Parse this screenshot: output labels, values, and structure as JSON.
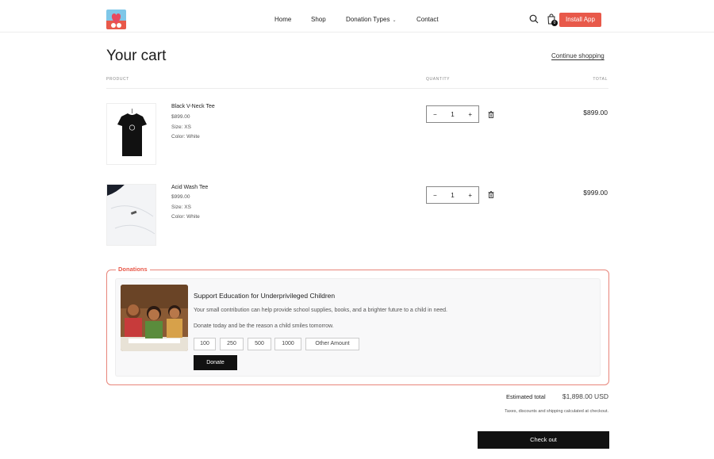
{
  "header": {
    "nav": [
      "Home",
      "Shop",
      "Donation Types",
      "Contact"
    ],
    "cart_count": "0",
    "install_label": "Install App"
  },
  "cart": {
    "title": "Your cart",
    "continue_label": "Continue shopping",
    "columns": {
      "product": "PRODUCT",
      "quantity": "QUANTITY",
      "total": "TOTAL"
    },
    "items": [
      {
        "name": "Black V-Neck Tee",
        "price": "$899.00",
        "size": "Size: XS",
        "color": "Color: White",
        "qty": "1",
        "total": "$899.00"
      },
      {
        "name": "Acid Wash Tee",
        "price": "$999.00",
        "size": "Size: XS",
        "color": "Color: White",
        "qty": "1",
        "total": "$999.00"
      }
    ],
    "minus": "−",
    "plus": "+"
  },
  "donations": {
    "legend": "Donations",
    "title": "Support Education for Underprivileged Children",
    "text1": "Your small contribution can help provide school supplies, books, and a brighter future to a child in need.",
    "text2": "Donate today and be the reason a child smiles tomorrow.",
    "amounts": [
      "100",
      "250",
      "500",
      "1000",
      "Other Amount"
    ],
    "donate_label": "Donate"
  },
  "summary": {
    "est_label": "Estimated total",
    "est_value": "$1,898.00 USD",
    "tax_note": "Taxes, discounts and shipping calculated at checkout.",
    "checkout_label": "Check out"
  },
  "colors": {
    "accent": "#e8594a",
    "dark": "#111111",
    "border_accent": "#e8857a"
  },
  "icons": [
    "search-icon",
    "cart-icon",
    "trash-icon",
    "chevron-down-icon"
  ]
}
